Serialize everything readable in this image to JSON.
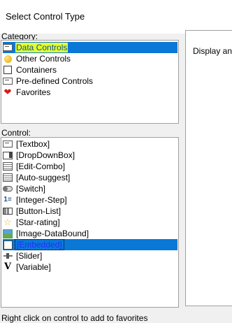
{
  "window": {
    "title": "Select Control Type"
  },
  "category": {
    "label": "Category:",
    "items": [
      {
        "label": "Data Controls",
        "icon": "data-controls-icon",
        "selected": true
      },
      {
        "label": "Other Controls",
        "icon": "yellow-circle-icon",
        "selected": false
      },
      {
        "label": "Containers",
        "icon": "container-box-icon",
        "selected": false
      },
      {
        "label": "Pre-defined Controls",
        "icon": "predefined-control-icon",
        "selected": false
      },
      {
        "label": "Favorites",
        "icon": "heart-icon",
        "selected": false
      }
    ]
  },
  "control": {
    "label": "Control:",
    "items": [
      {
        "label": "[Textbox]",
        "icon": "textbox-icon"
      },
      {
        "label": "[DropDownBox]",
        "icon": "dropdown-icon"
      },
      {
        "label": "[Edit-Combo]",
        "icon": "edit-combo-icon"
      },
      {
        "label": "[Auto-suggest]",
        "icon": "auto-suggest-icon"
      },
      {
        "label": "[Switch]",
        "icon": "switch-icon"
      },
      {
        "label": "[Integer-Step]",
        "icon": "integer-step-icon"
      },
      {
        "label": "[Button-List]",
        "icon": "button-list-icon"
      },
      {
        "label": "[Star-rating]",
        "icon": "star-icon"
      },
      {
        "label": "[Image-DataBound]",
        "icon": "image-icon"
      },
      {
        "label": "[Embedded]",
        "icon": "embedded-icon",
        "selected": true
      },
      {
        "label": "[Slider]",
        "icon": "slider-icon"
      },
      {
        "label": "[Variable]",
        "icon": "variable-icon"
      }
    ]
  },
  "description": {
    "text": "Display an e"
  },
  "footer": {
    "hint": "Right click on control to add to favorites"
  },
  "colors": {
    "selection": "#0a78d7",
    "highlight": "#e8ff2a",
    "panel_bg": "#f0f0f0"
  }
}
